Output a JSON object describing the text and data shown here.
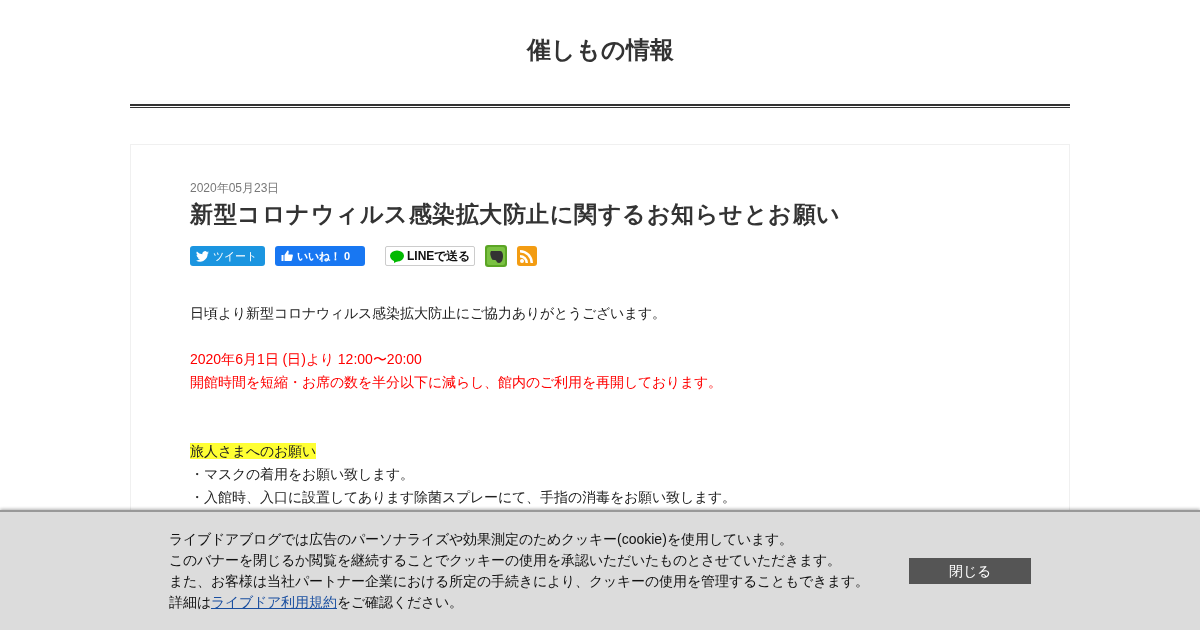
{
  "blog_title": "催しもの情報",
  "article": {
    "date": "2020年05月23日",
    "title": "新型コロナウィルス感染拡大防止に関するお知らせとお願い",
    "share": {
      "tweet": "ツイート",
      "like": "いいね！ 0",
      "line": "LINEで送る"
    },
    "body": [
      {
        "kind": "text",
        "text": "日頃より新型コロナウィルス感染拡大防止にご協力ありがとうございます。"
      },
      {
        "kind": "gap"
      },
      {
        "kind": "alert",
        "text": "2020年6月1日 (日)より 12:00〜20:00"
      },
      {
        "kind": "alert",
        "text": "開館時間を短縮・お席の数を半分以下に減らし、館内のご利用を再開しております。"
      },
      {
        "kind": "gap"
      },
      {
        "kind": "gap"
      },
      {
        "kind": "highlight",
        "text": "旅人さまへのお願い"
      },
      {
        "kind": "text",
        "text": "・マスクの着用をお願い致します。"
      },
      {
        "kind": "text",
        "text": "・入館時、入口に設置してあります除菌スプレーにて、手指の消毒をお願い致します。"
      }
    ]
  },
  "cookie_banner": {
    "lines": [
      "ライブドアブログでは広告のパーソナライズや効果測定のためクッキー(cookie)を使用しています。",
      "このバナーを閉じるか閲覧を継続することでクッキーの使用を承認いただいたものとさせていただきます。",
      "また、お客様は当社パートナー企業における所定の手続きにより、クッキーの使用を管理することもできます。"
    ],
    "detail_before": "詳細は",
    "detail_link": "ライブドア利用規約",
    "detail_after": "をご確認ください。",
    "close_button": "閉じる"
  }
}
